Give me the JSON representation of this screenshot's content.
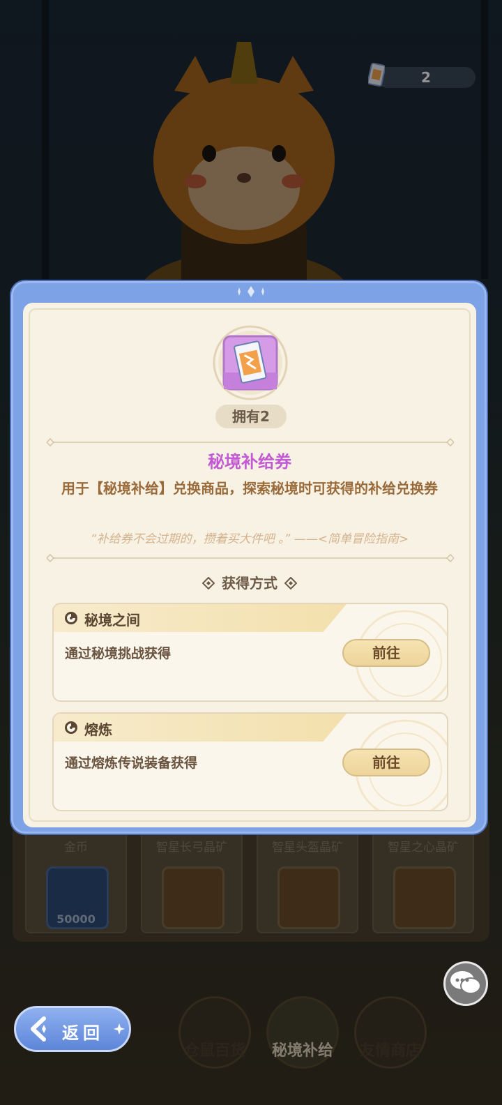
{
  "ticket_counter": {
    "value": "2"
  },
  "shop_items": [
    {
      "name": "金币",
      "amount": "50000"
    },
    {
      "name": "智星长弓晶矿"
    },
    {
      "name": "智星头盔晶矿"
    },
    {
      "name": "智星之心晶矿"
    }
  ],
  "nav": {
    "tabs": [
      {
        "label": "仓鼠百货"
      },
      {
        "label": "秘境补给"
      },
      {
        "label": "友情商店"
      }
    ],
    "back_label": "返回"
  },
  "modal": {
    "owned": "拥有2",
    "item_name": "秘境补给券",
    "item_desc": "用于【秘境补给】兑换商品，探索秘境时可获得的补给兑换券",
    "item_quote": "“补给券不会过期的，攒着买大件吧 。” ——<简单冒险指南>",
    "obtain_title": "获得方式",
    "sources": [
      {
        "title": "秘境之间",
        "desc": "通过秘境挑战获得",
        "button": "前往"
      },
      {
        "title": "熔炼",
        "desc": "通过熔炼传说装备获得",
        "button": "前往"
      }
    ]
  },
  "colors": {
    "accent_purple": "#c25bd3",
    "modal_frame": "#7da2e6",
    "panel_bg": "#f8f2e4",
    "button_gold": "#edd49a"
  },
  "icons": {
    "item": "ticket-icon",
    "counter": "ticket-icon",
    "source_tab": "swirl-icon",
    "title_decor": "diamond-icon",
    "back": "back-arrow-icon",
    "chat": "chat-bubble-icon"
  }
}
